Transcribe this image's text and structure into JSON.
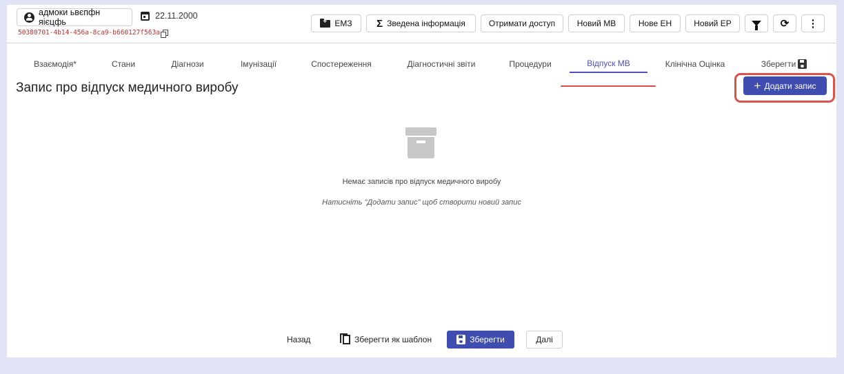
{
  "patient": {
    "name": "адмоки ьвєпфн яієцфь",
    "birth_date": "22.11.2000",
    "uuid": "50380701-4b14-456a-8ca9-b660127f563a"
  },
  "toolbar": {
    "ehr_label": "ЕМЗ",
    "summary_label": "Зведена інформація",
    "access_label": "Отримати доступ",
    "new_mv_label": "Новий МВ",
    "new_en_label": "Нове ЕН",
    "new_ep_label": "Новий ЕР"
  },
  "tabs": [
    {
      "label": "Взаємодія*"
    },
    {
      "label": "Стани"
    },
    {
      "label": "Діагнози"
    },
    {
      "label": "Імунізації"
    },
    {
      "label": "Спостереження"
    },
    {
      "label": "Діагностичні звіти"
    },
    {
      "label": "Процедури"
    },
    {
      "label": "Відпуск МВ",
      "active": true
    },
    {
      "label": "Клінічна Оцінка"
    },
    {
      "label": "Зберегти"
    }
  ],
  "main": {
    "title": "Запис про відпуск медичного виробу",
    "add_button_label": "Додати запис",
    "empty_text": "Немає записів про відпуск медичного виробу",
    "empty_hint": "Натисніть \"Додати запис\" щоб створити новий запис"
  },
  "footer": {
    "back_label": "Назад",
    "save_template_label": "Зберегти як шаблон",
    "save_label": "Зберегти",
    "next_label": "Далі"
  },
  "colors": {
    "accent": "#3f4db0",
    "highlight": "#e0504a",
    "background": "#dfe3f3"
  }
}
